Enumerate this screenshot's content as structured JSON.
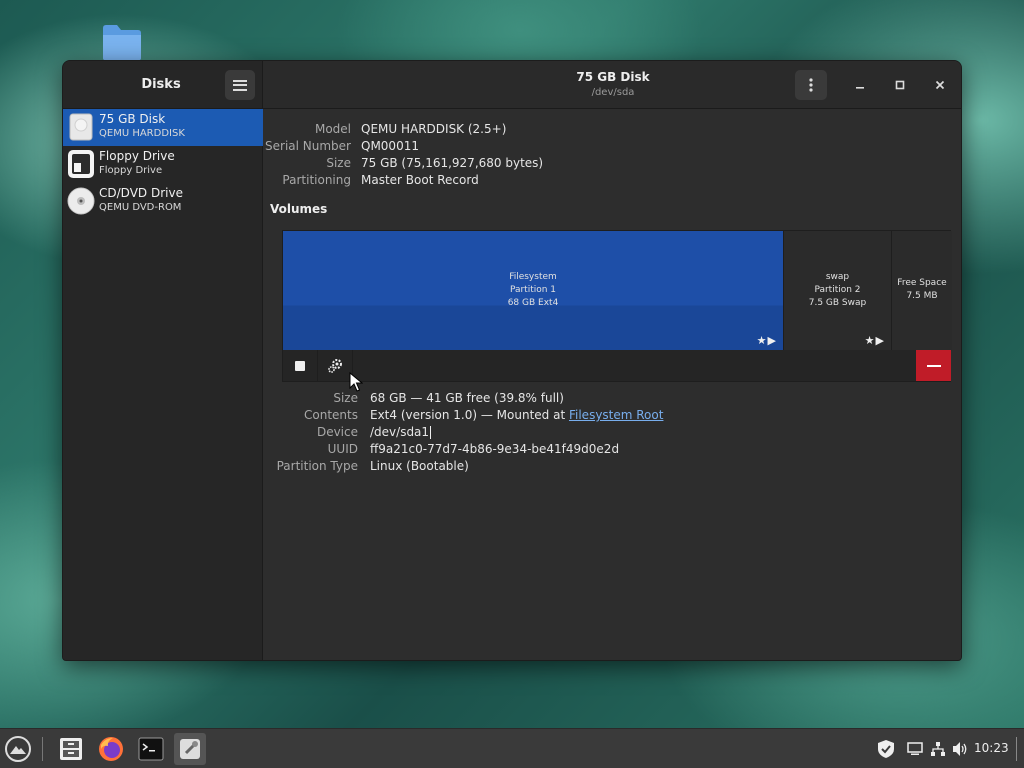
{
  "window": {
    "sidebar_title": "Disks",
    "header_title": "75 GB Disk",
    "header_subtitle": "/dev/sda"
  },
  "drives": [
    {
      "name": "75 GB Disk",
      "sub": "QEMU HARDDISK",
      "icon": "hard-disk-icon",
      "selected": true
    },
    {
      "name": "Floppy Drive",
      "sub": "Floppy Drive",
      "icon": "floppy-icon",
      "selected": false
    },
    {
      "name": "CD/DVD Drive",
      "sub": "QEMU DVD-ROM",
      "icon": "optical-disc-icon",
      "selected": false
    }
  ],
  "disk_info": {
    "model_label": "Model",
    "model": "QEMU HARDDISK (2.5+)",
    "serial_label": "Serial Number",
    "serial": "QM00011",
    "size_label": "Size",
    "size": "75 GB (75,161,927,680 bytes)",
    "partitioning_label": "Partitioning",
    "partitioning": "Master Boot Record"
  },
  "volumes_title": "Volumes",
  "volumes": {
    "fs": {
      "line1": "Filesystem",
      "line2": "Partition 1",
      "line3": "68 GB Ext4",
      "icons": "★▶"
    },
    "swap": {
      "line1": "swap",
      "line2": "Partition 2",
      "line3": "7.5 GB Swap",
      "icons": "★▶"
    },
    "free": {
      "line1": "Free Space",
      "line2": "7.5 MB"
    }
  },
  "partition_info": {
    "size_label": "Size",
    "size": "68 GB — 41 GB free (39.8% full)",
    "contents_label": "Contents",
    "contents_prefix": "Ext4 (version 1.0) — Mounted at ",
    "contents_link": "Filesystem Root",
    "device_label": "Device",
    "device": "/dev/sda1",
    "uuid_label": "UUID",
    "uuid": "ff9a21c0-77d7-4b86-9e34-be41f49d0e2d",
    "ptype_label": "Partition Type",
    "ptype": "Linux (Bootable)"
  },
  "taskbar": {
    "clock": "10:23"
  },
  "colors": {
    "accent": "#1c5bb3",
    "partition_fill": "#1e4fa8",
    "delete": "#c01c28",
    "link": "#78aeed"
  }
}
